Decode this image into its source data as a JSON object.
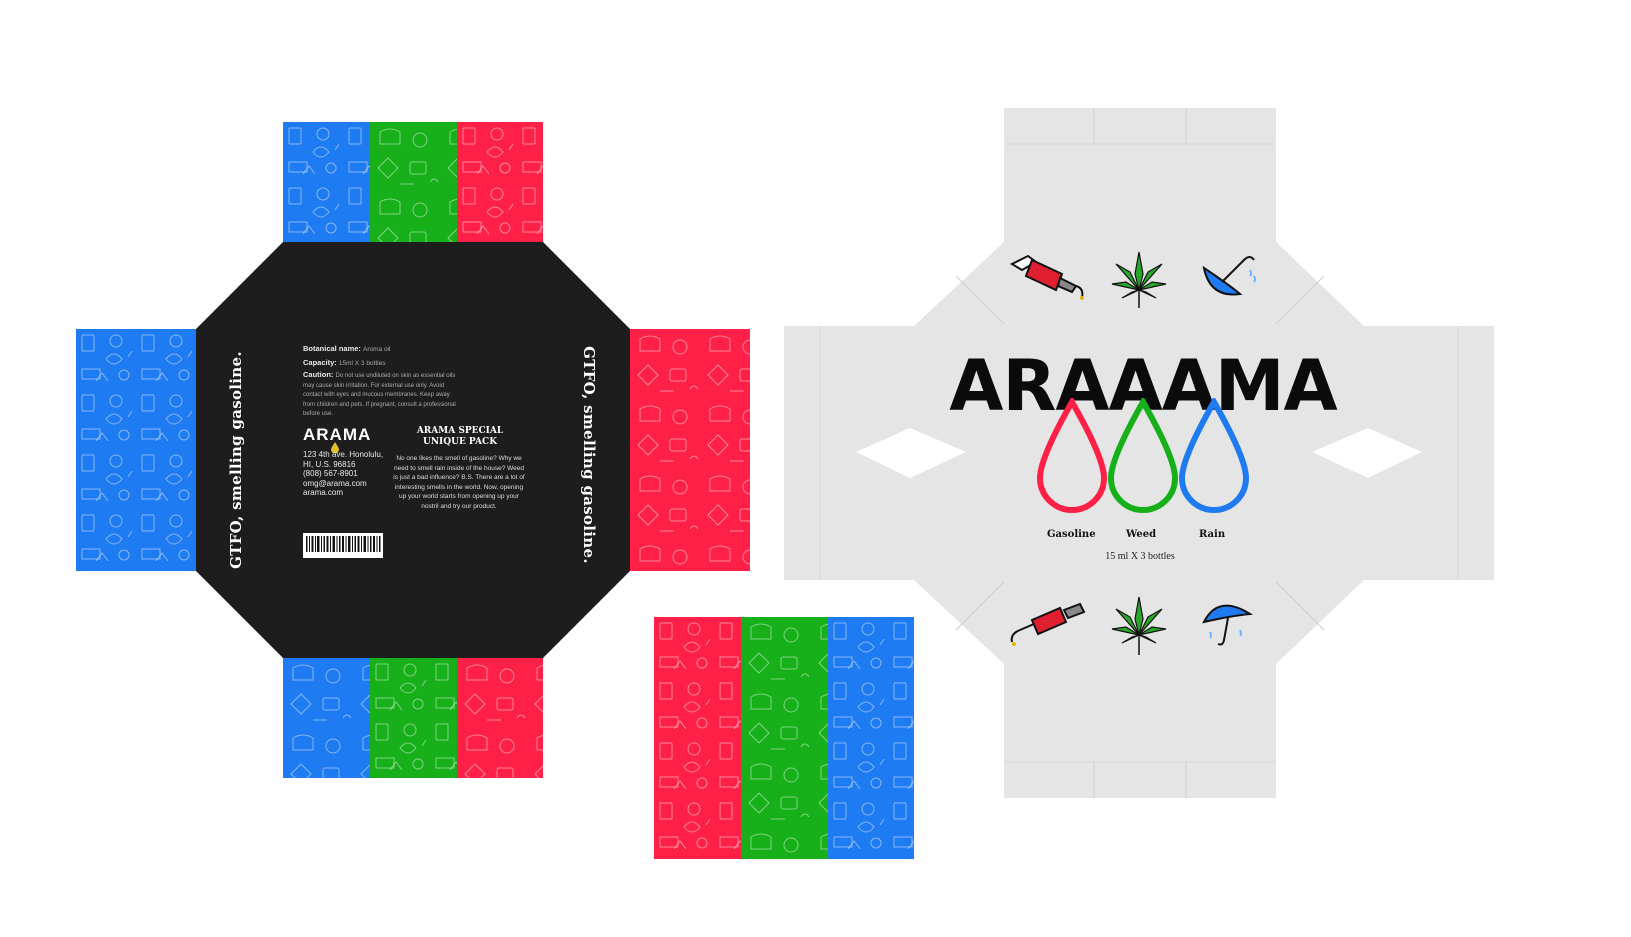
{
  "colors": {
    "blue": "#1f7bf2",
    "green": "#17b01a",
    "red": "#ff2047",
    "black_panel": "#1d1d1d",
    "gray_panel": "#e5e5e5"
  },
  "left_box": {
    "side_tagline": "GTFO, smelling gasoline.",
    "botanical_label": "Botanical name:",
    "botanical_value": "Aroma oil",
    "capacity_label": "Capacity:",
    "capacity_value": "15ml X 3 bottles",
    "caution_label": "Caution:",
    "caution_text": "Do not use undiluted on skin as essential oils may cause skin irritation. For external use only. Avoid contact with eyes and mucous membranes. Keep away from children and pets. If pregnant, consult a professional before use.",
    "logo_text": "ARAMA",
    "address_line1": "123 4th ave. Honolulu,",
    "address_line2": "HI, U.S. 96816",
    "phone": "(808) 567-8901",
    "email": "omg@arama.com",
    "website": "arama.com",
    "pack_title_line1": "ARAMA SPECIAL",
    "pack_title_line2": "UNIQUE PACK",
    "pack_description": "No one likes the smell of gasoline? Why we need to smell rain inside of the house? Weed is just a bad influence? B.S. There are a lot of interesting smells in the world. Now, opening up your world starts from opening up your nostril and try our product."
  },
  "right_box": {
    "brand_title": "ARAAAMA",
    "scents": [
      "Gasoline",
      "Weed",
      "Rain"
    ],
    "capacity_text": "15 ml X 3 bottles",
    "top_icons": [
      "gas-nozzle-icon",
      "cannabis-leaf-icon",
      "umbrella-icon"
    ],
    "bottom_icons": [
      "gas-nozzle-icon",
      "cannabis-leaf-icon",
      "umbrella-icon"
    ]
  }
}
